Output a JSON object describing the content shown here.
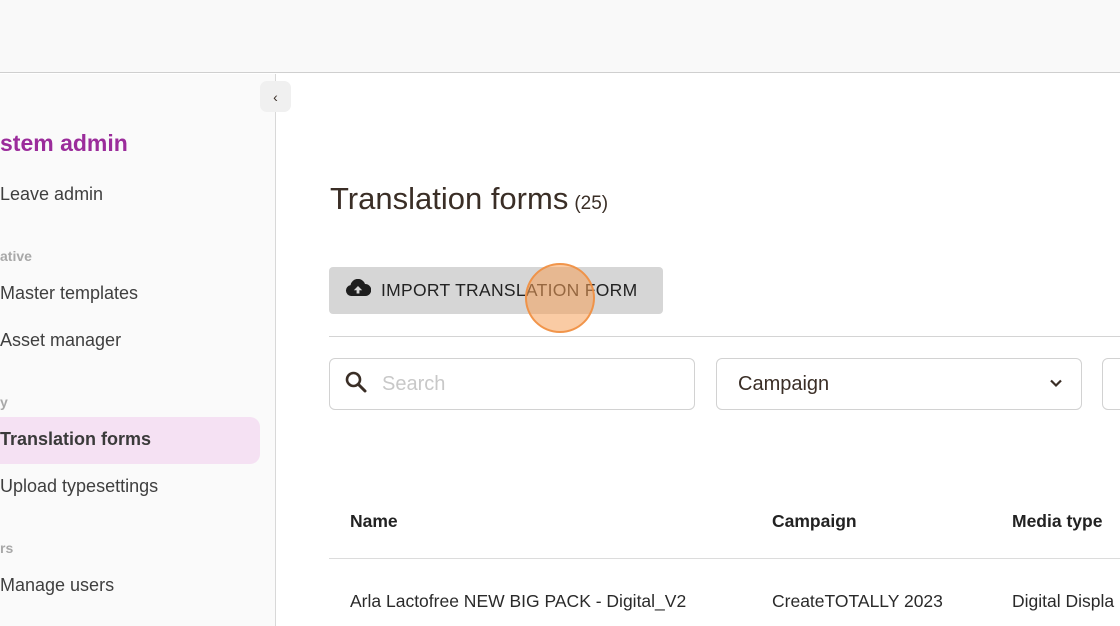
{
  "sidebar": {
    "title": "stem admin",
    "collapse_icon": "chevron-left-icon",
    "items": [
      {
        "type": "item",
        "label": "Leave admin"
      },
      {
        "type": "section",
        "label": "ative"
      },
      {
        "type": "item",
        "label": "Master templates"
      },
      {
        "type": "item",
        "label": "Asset manager"
      },
      {
        "type": "section",
        "label": "y"
      },
      {
        "type": "item",
        "label": "Translation forms",
        "active": true
      },
      {
        "type": "item",
        "label": "Upload typesettings"
      },
      {
        "type": "section",
        "label": "rs"
      },
      {
        "type": "item",
        "label": "Manage users"
      }
    ]
  },
  "main": {
    "title": "Translation forms",
    "count": "(25)",
    "import_button": {
      "label": "IMPORT TRANSLATION FORM",
      "icon": "cloud-upload-icon"
    },
    "search": {
      "placeholder": "Search",
      "value": "",
      "icon": "search-icon"
    },
    "filters": [
      {
        "value": "Campaign",
        "icon": "chevron-down-icon"
      }
    ],
    "table": {
      "columns": [
        "Name",
        "Campaign",
        "Media type"
      ],
      "rows": [
        [
          "Arla Lactofree NEW BIG PACK - Digital_V2",
          "CreateTOTALLY 2023",
          "Digital Displa"
        ]
      ]
    }
  },
  "colors": {
    "brand": "#9b2c9b",
    "active_item_bg": "#f5e1f3",
    "button_bg": "#d6d6d6",
    "click_marker": "#f5a05a"
  }
}
